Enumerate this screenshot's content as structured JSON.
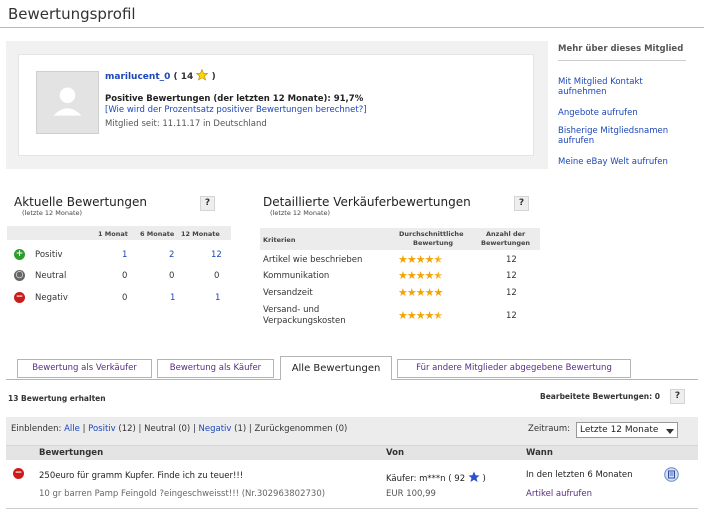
{
  "page_title": "Bewertungsprofil",
  "profile": {
    "username": "marilucent_0",
    "score_open": "(",
    "score": "14",
    "score_close": ")",
    "positive_text": "Positive Bewertungen (der letzten 12 Monate): 91,7%",
    "calc_link": "[Wie wird der Prozentsatz positiver Bewertungen berechnet?]",
    "member_since": "Mitglied seit: 11.11.17 in Deutschland"
  },
  "sidebar": {
    "heading": "Mehr über dieses Mitglied",
    "links": [
      "Mit Mitglied Kontakt aufnehmen",
      "Angebote aufrufen",
      "Bisherige Mitgliedsnamen aufrufen",
      "Meine eBay Welt aufrufen"
    ]
  },
  "current_ratings": {
    "title": "Aktuelle Bewertungen",
    "subtitle": "(letzte 12 Monate)",
    "help": "?",
    "columns": [
      "1 Monat",
      "6 Monate",
      "12 Monate"
    ],
    "rows": [
      {
        "label": "Positiv",
        "values": [
          "1",
          "2",
          "12"
        ]
      },
      {
        "label": "Neutral",
        "values": [
          "0",
          "0",
          "0"
        ]
      },
      {
        "label": "Negativ",
        "values": [
          "0",
          "1",
          "1"
        ]
      }
    ]
  },
  "seller_ratings": {
    "title": "Detaillierte Verkäuferbewertungen",
    "subtitle": "(letzte 12 Monate)",
    "help": "?",
    "col_criteria": "Kriterien",
    "col_avg_1": "Durchschnittliche",
    "col_avg_2": "Bewertung",
    "col_count_1": "Anzahl der",
    "col_count_2": "Bewertungen",
    "rows": [
      {
        "label": "Artikel wie beschrieben",
        "stars": 4.5,
        "count": "12"
      },
      {
        "label": "Kommunikation",
        "stars": 4.5,
        "count": "12"
      },
      {
        "label": "Versandzeit",
        "stars": 5,
        "count": "12"
      },
      {
        "label": "Versand- und Verpackungskosten",
        "stars": 4.5,
        "count": "12"
      }
    ]
  },
  "tabs": [
    {
      "label": "Bewertung als Verkäufer",
      "active": false
    },
    {
      "label": "Bewertung als Käufer",
      "active": false
    },
    {
      "label": "Alle Bewertungen",
      "active": true
    },
    {
      "label": "Für andere Mitglieder abgegebene Bewertung",
      "active": false
    }
  ],
  "received": {
    "count_label": "13 Bewertung erhalten",
    "edited_label": "Bearbeitete Bewertungen: 0",
    "help": "?"
  },
  "filter": {
    "label": "Einblenden:",
    "all": "Alle",
    "positive": "Positiv",
    "positive_count": "(12)",
    "neutral": "Neutral (0)",
    "negative": "Negativ",
    "negative_count": "(1)",
    "withdrawn": "Zurückgenommen (0)",
    "sep": "|",
    "period_label": "Zeitraum:",
    "period_value": "Letzte 12 Monate"
  },
  "feedback_table": {
    "col_ratings": "Bewertungen",
    "col_from": "Von",
    "col_when": "Wann",
    "rows": [
      {
        "comment": "250euro für gramm Kupfer. Finde ich zu teuer!!!",
        "item": "10 gr barren Pamp Feingold ?eingeschweisst!!! (Nr.302963802730)",
        "from": "Käufer: m***n (",
        "from_score": "92",
        "from_close": ")",
        "price": "EUR 100,99",
        "when": "In den letzten 6 Monaten",
        "view_link": "Artikel aufrufen"
      }
    ]
  },
  "colors": {
    "link": "#1b47b8",
    "tab_text": "#5a2c82",
    "positive": "#2e9d2e",
    "negative": "#cc1b1b",
    "star": "#f5a300"
  }
}
